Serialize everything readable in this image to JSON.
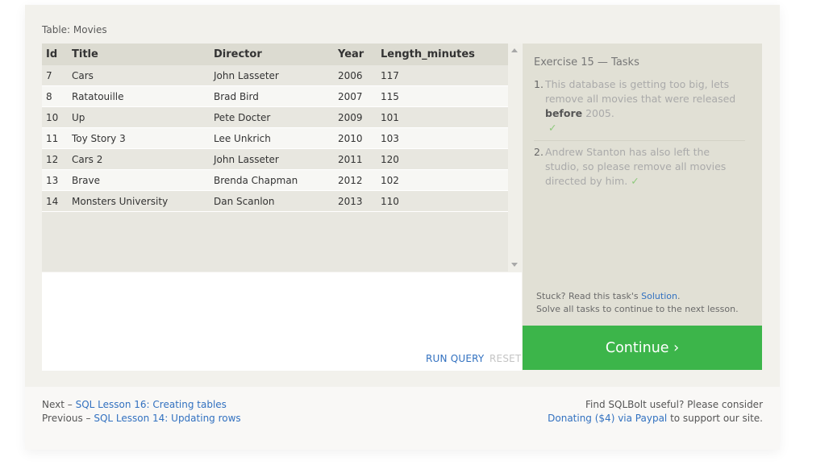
{
  "table": {
    "caption": "Table: Movies",
    "columns": [
      "Id",
      "Title",
      "Director",
      "Year",
      "Length_minutes"
    ],
    "rows": [
      [
        "7",
        "Cars",
        "John Lasseter",
        "2006",
        "117"
      ],
      [
        "8",
        "Ratatouille",
        "Brad Bird",
        "2007",
        "115"
      ],
      [
        "10",
        "Up",
        "Pete Docter",
        "2009",
        "101"
      ],
      [
        "11",
        "Toy Story 3",
        "Lee Unkrich",
        "2010",
        "103"
      ],
      [
        "12",
        "Cars 2",
        "John Lasseter",
        "2011",
        "120"
      ],
      [
        "13",
        "Brave",
        "Brenda Chapman",
        "2012",
        "102"
      ],
      [
        "14",
        "Monsters University",
        "Dan Scanlon",
        "2013",
        "110"
      ]
    ]
  },
  "editor": {
    "run_label": "RUN QUERY",
    "reset_label": "RESET"
  },
  "tasks": {
    "title": "Exercise 15 — Tasks",
    "items": [
      {
        "number": "1.",
        "text_before": "This database is getting too big, lets remove all movies that were released ",
        "bold": "before",
        "text_after": " 2005.",
        "check": "✓"
      },
      {
        "number": "2.",
        "text_before": "Andrew Stanton has also left the studio, so please remove all movies directed by him.",
        "bold": "",
        "text_after": "",
        "check": "✓"
      }
    ],
    "stuck_prefix": "Stuck? Read this task's ",
    "solution_link": "Solution",
    "stuck_suffix": ".",
    "solve_all": "Solve all tasks to continue to the next lesson.",
    "continue_label": "Continue ›"
  },
  "footer": {
    "next_prefix": "Next – ",
    "next_link": "SQL Lesson 16: Creating tables",
    "previous_prefix": "Previous – ",
    "previous_link": "SQL Lesson 14: Updating rows",
    "useful_text": "Find SQLBolt useful? Please consider",
    "donate_link": "Donating ($4) via Paypal",
    "donate_suffix": " to support our site."
  },
  "colors": {
    "accent_link": "#3271c0",
    "continue_bg": "#3cb54a",
    "check": "#8cc97a"
  }
}
